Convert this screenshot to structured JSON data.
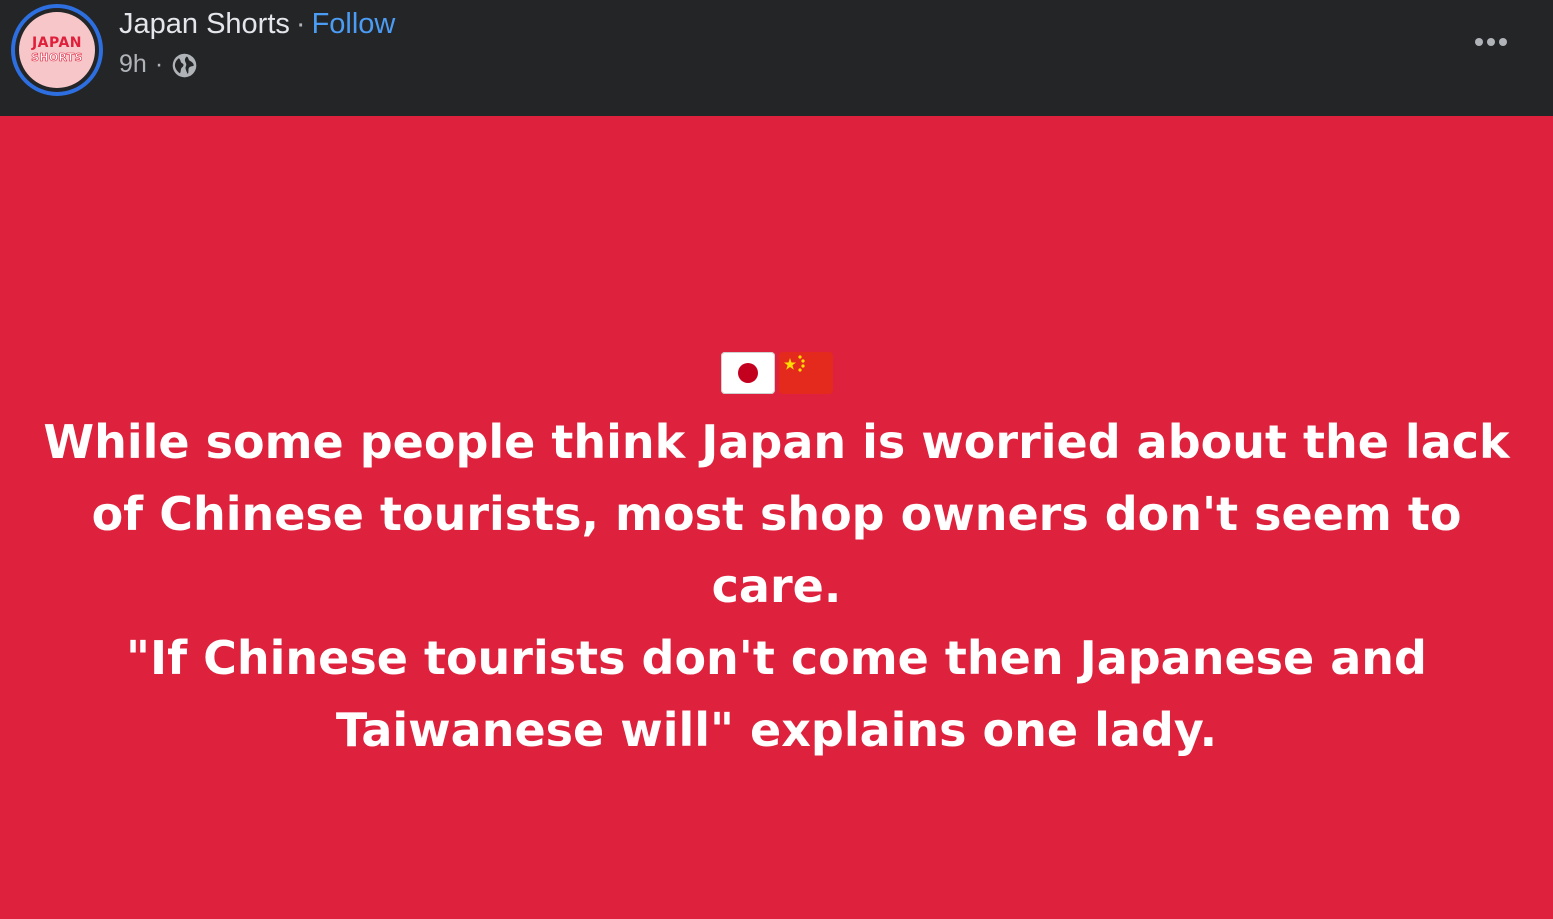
{
  "post": {
    "page_name": "Japan Shorts",
    "separator": "·",
    "follow_label": "Follow",
    "timestamp": "9h",
    "meta_separator": "·",
    "audience_icon": "globe-icon",
    "more_icon": "more-options-icon",
    "avatar": {
      "line1": "JAPAN",
      "line2": "SHORTS"
    }
  },
  "content": {
    "background_color": "#de213c",
    "flags": [
      "japan-flag",
      "china-flag"
    ],
    "paragraph_1": "While some people think Japan is worried about the lack of Chinese tourists, most shop owners don't seem to care.",
    "paragraph_2": "\"If Chinese tourists don't come then Japanese and Taiwanese will\" explains one lady."
  },
  "colors": {
    "header_bg": "#242526",
    "follow_link": "#4b9cf5",
    "avatar_ring": "#2d6fe0"
  }
}
